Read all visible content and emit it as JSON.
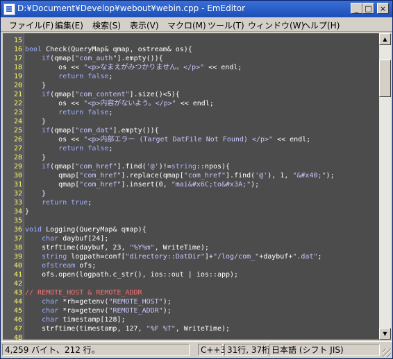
{
  "window": {
    "title": "D:¥Document¥Develop¥webout¥webin.cpp - EmEditor"
  },
  "controls": {
    "minimize": "_",
    "maximize": "□",
    "close": "×"
  },
  "menu": [
    "ファイル(F)",
    "編集(E)",
    "検索(S)",
    "表示(V)",
    "マクロ(M)",
    "ツール(T)",
    "ウィンドウ(W)",
    "ヘルプ(H)"
  ],
  "editor": {
    "lines": [
      {
        "n": "15",
        "t": ""
      },
      {
        "n": "16",
        "t": "bool Check(QueryMap& qmap, ostream& os){"
      },
      {
        "n": "17",
        "t": "    if(qmap[\"com_auth\"].empty()){"
      },
      {
        "n": "18",
        "t": "        os << \"<p>なまえがみつかりません。</p>\" << endl;"
      },
      {
        "n": "19",
        "t": "        return false;"
      },
      {
        "n": "20",
        "t": "    }"
      },
      {
        "n": "21",
        "t": "    if(qmap[\"com_content\"].size()<5){"
      },
      {
        "n": "22",
        "t": "        os << \"<p>内容がないよう。</p>\" << endl;"
      },
      {
        "n": "23",
        "t": "        return false;"
      },
      {
        "n": "24",
        "t": "    }"
      },
      {
        "n": "25",
        "t": "    if(qmap[\"com_dat\"].empty()){"
      },
      {
        "n": "26",
        "t": "        os << \"<p>内部エラー (Target DatFile Not Found) </p>\" << endl;"
      },
      {
        "n": "27",
        "t": "        return false;"
      },
      {
        "n": "28",
        "t": "    }"
      },
      {
        "n": "29",
        "t": "    if(qmap[\"com_href\"].find('@')!=string::npos){"
      },
      {
        "n": "30",
        "t": "        qmap[\"com_href\"].replace(qmap[\"com_href\"].find('@'), 1, \"&#x40;\");"
      },
      {
        "n": "31",
        "t": "        qmap[\"com_href\"].insert(0, \"mai&#x6C;to&#x3A;\");"
      },
      {
        "n": "32",
        "t": "    }"
      },
      {
        "n": "33",
        "t": "    return true;"
      },
      {
        "n": "34",
        "t": "}"
      },
      {
        "n": "35",
        "t": ""
      },
      {
        "n": "36",
        "t": "void Logging(QueryMap& qmap){"
      },
      {
        "n": "37",
        "t": "    char daybuf[24];"
      },
      {
        "n": "38",
        "t": "    strftime(daybuf, 23, \"%Y%m\", WriteTime);"
      },
      {
        "n": "39",
        "t": "    string logpath=conf[\"directory::DatDir\"]+\"/log/com_\"+daybuf+\".dat\";"
      },
      {
        "n": "40",
        "t": "    ofstream ofs;"
      },
      {
        "n": "41",
        "t": "    ofs.open(logpath.c_str(), ios::out | ios::app);"
      },
      {
        "n": "42",
        "t": ""
      },
      {
        "n": "43",
        "t": "// REMOTE_HOST & REMOTE_ADDR"
      },
      {
        "n": "44",
        "t": "    char *rh=getenv(\"REMOTE_HOST\");"
      },
      {
        "n": "45",
        "t": "    char *ra=getenv(\"REMOTE_ADDR\");"
      },
      {
        "n": "46",
        "t": "    char timestamp[128];"
      },
      {
        "n": "47",
        "t": "    strftime(timestamp, 127, \"%F %T\", WriteTime);"
      },
      {
        "n": "48",
        "t": ""
      }
    ]
  },
  "status": {
    "size": "4,259 バイト、212 行。",
    "mode": "C++3",
    "position": "31行, 37桁",
    "encoding": "日本語 (シフト JIS)"
  },
  "colors": {
    "editor_bg": "#4c4c4c",
    "line_number": "#ffff66",
    "keyword": "#a0b0ff",
    "string": "#c8c8ff",
    "comment": "#ff7070",
    "title_bar": "#2b5fc9"
  }
}
